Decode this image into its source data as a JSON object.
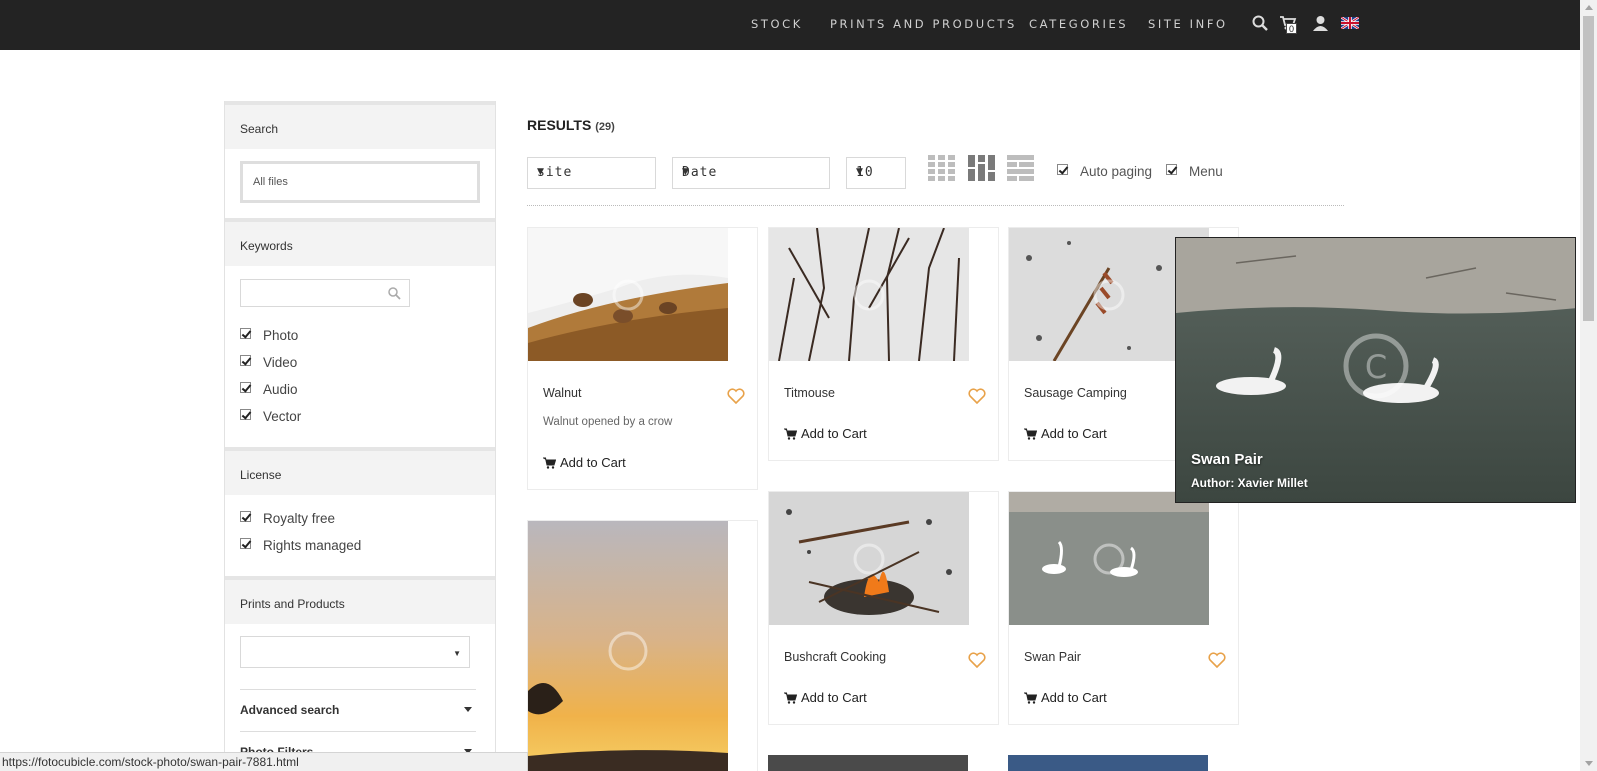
{
  "nav": {
    "items": [
      "STOCK",
      "PRINTS AND PRODUCTS",
      "CATEGORIES",
      "SITE INFO"
    ],
    "cart_count": "0"
  },
  "sidebar": {
    "search": {
      "heading": "Search",
      "value": "All files"
    },
    "keywords": {
      "heading": "Keywords",
      "placeholder": "",
      "options": [
        "Photo",
        "Video",
        "Audio",
        "Vector"
      ]
    },
    "license": {
      "heading": "License",
      "options": [
        "Royalty free",
        "Rights managed"
      ]
    },
    "prints": {
      "heading": "Prints and Products",
      "selected": ""
    },
    "advanced_search": "Advanced search",
    "photo_filters": "Photo Filters"
  },
  "results": {
    "label": "RESULTS",
    "count": "(29)",
    "filter_site": "site",
    "sort": "Date",
    "per_page": "10",
    "auto_paging": "Auto paging",
    "menu": "Menu"
  },
  "cards": [
    {
      "title": "Walnut",
      "desc": "Walnut opened by a crow",
      "cart": "Add to Cart"
    },
    {
      "title": "Titmouse",
      "desc": "",
      "cart": "Add to Cart"
    },
    {
      "title": "Sausage Camping",
      "desc": "",
      "cart": "Add to Cart"
    },
    {
      "title": "Bushcraft Cooking",
      "desc": "",
      "cart": "Add to Cart"
    },
    {
      "title": "Swan Pair",
      "desc": "",
      "cart": "Add to Cart"
    }
  ],
  "popup": {
    "title": "Swan Pair",
    "author": "Author: Xavier Millet"
  },
  "status_url": "https://fotocubicle.com/stock-photo/swan-pair-7881.html",
  "colors": {
    "topbar": "#232323",
    "heart": "#e8a24a",
    "sidebar_head": "#f3f3f3"
  },
  "icons": [
    "search-icon",
    "cart-icon",
    "user-icon",
    "flag-uk-icon",
    "heart-icon",
    "grid-view-icon",
    "masonry-view-icon",
    "list-view-icon"
  ]
}
